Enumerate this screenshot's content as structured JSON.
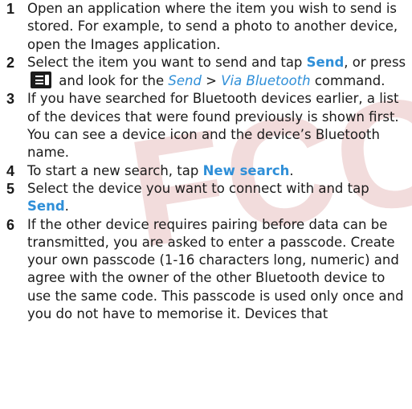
{
  "watermark": "FCC",
  "steps": [
    {
      "num": "1",
      "text": "Open an application where the item you wish to send is stored. For example, to send a photo to another device, open the Images application."
    },
    {
      "num": "2",
      "t1": "Select the item you want to send and tap ",
      "link_send": "Send",
      "t2": ", or press",
      "t3": "and look for the ",
      "menu_send": "Send",
      "sep": " > ",
      "menu_bt": "Via Bluetooth",
      "t4": " command."
    },
    {
      "num": "3",
      "text": "If you have searched for Bluetooth devices earlier, a list of the devices that were found previously is shown first. You can see a device icon and the device’s Bluetooth name."
    },
    {
      "num": "4",
      "t1": "To start a new search, tap ",
      "link": "New search",
      "t2": "."
    },
    {
      "num": "5",
      "t1": "Select the device you want to connect with and tap ",
      "link": "Send",
      "t2": "."
    },
    {
      "num": "6",
      "text": "If the other device requires pairing before data can be transmitted, you are asked to enter a passcode. Create your own passcode (1-16 characters long, numeric) and agree with the owner of the other Bluetooth device to use the same code. This passcode is used only once and you do not have to memorise it. Devices that"
    }
  ],
  "icons": {
    "menu_key": "menu-key-icon"
  }
}
